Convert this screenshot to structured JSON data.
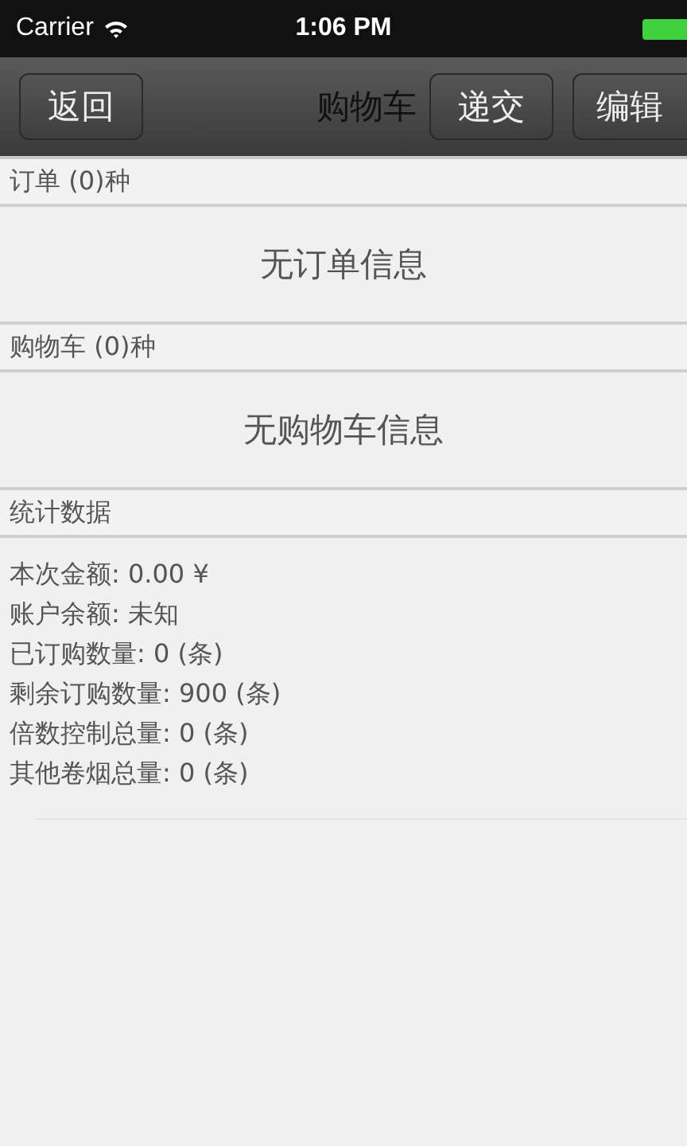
{
  "status_bar": {
    "carrier": "Carrier",
    "time": "1:06 PM"
  },
  "nav_bar": {
    "title": "购物车",
    "back_button": "返回",
    "buttons": [
      "递交",
      "编辑"
    ]
  },
  "sections": [
    {
      "kind": "message",
      "header": "订单 (0)种",
      "message": "无订单信息"
    },
    {
      "kind": "message",
      "header": "购物车 (0)种",
      "message": "无购物车信息"
    },
    {
      "kind": "stats",
      "header": "统计数据",
      "lines": [
        "本次金额: 0.00 ¥",
        "账户余额: 未知",
        "已订购数量: 0 (条)",
        "剩余订购数量: 900 (条)",
        "倍数控制总量: 0 (条)",
        "其他卷烟总量: 0 (条)"
      ]
    }
  ]
}
